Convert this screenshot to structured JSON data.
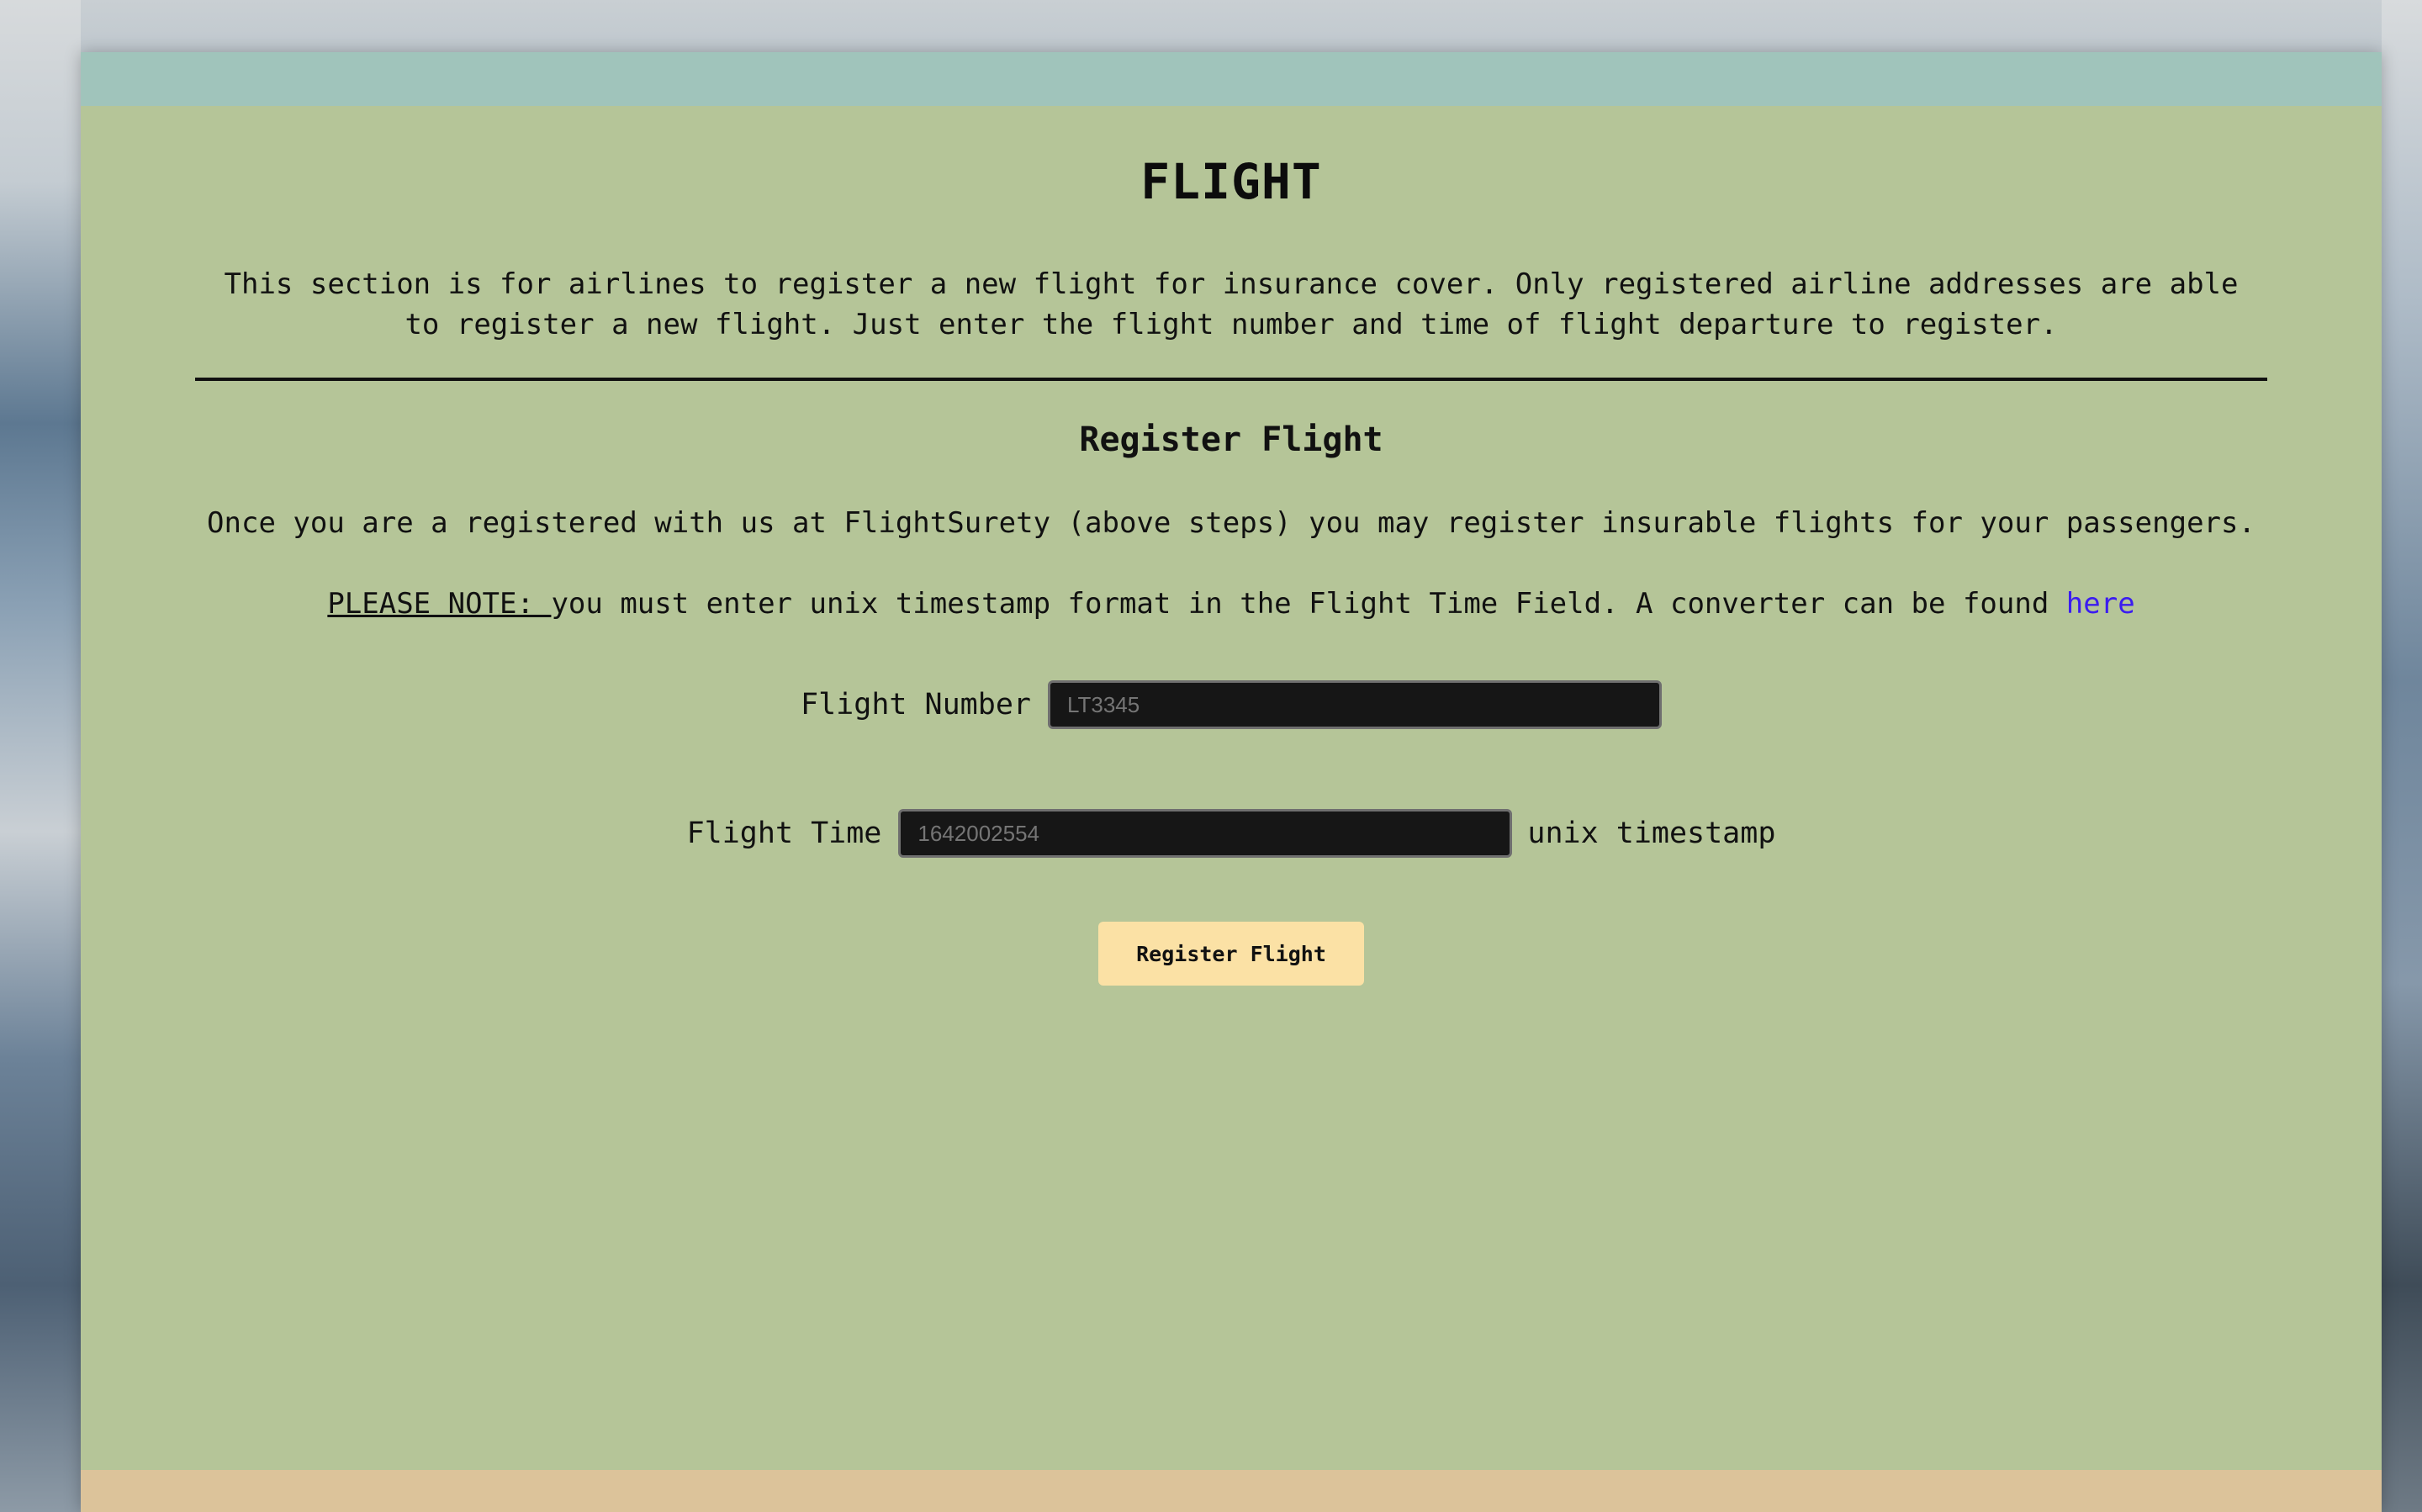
{
  "page": {
    "title": "FLIGHT",
    "intro": "This section is for airlines to register a new flight for insurance cover. Only registered airline addresses are able to register a new flight. Just enter the flight number and time of flight departure to register."
  },
  "register": {
    "heading": "Register Flight",
    "description": "Once you are a registered with us at FlightSurety (above steps) you may register insurable flights for your passengers.",
    "note_label": "PLEASE NOTE: ",
    "note_text": "you must enter unix timestamp format in the Flight Time Field. A converter can be found ",
    "note_link": "here",
    "flight_number": {
      "label": "Flight Number",
      "placeholder": "LT3345",
      "value": ""
    },
    "flight_time": {
      "label": "Flight Time",
      "placeholder": "1642002554",
      "value": "",
      "suffix": "unix timestamp"
    },
    "submit_label": "Register Flight"
  },
  "colors": {
    "panel": "#b5c598",
    "top_bar": "#a0c4bb",
    "bottom_bar": "#dcc39a",
    "button": "#fbe1a5",
    "link": "#3b1cf0",
    "input_bg": "#161616"
  }
}
